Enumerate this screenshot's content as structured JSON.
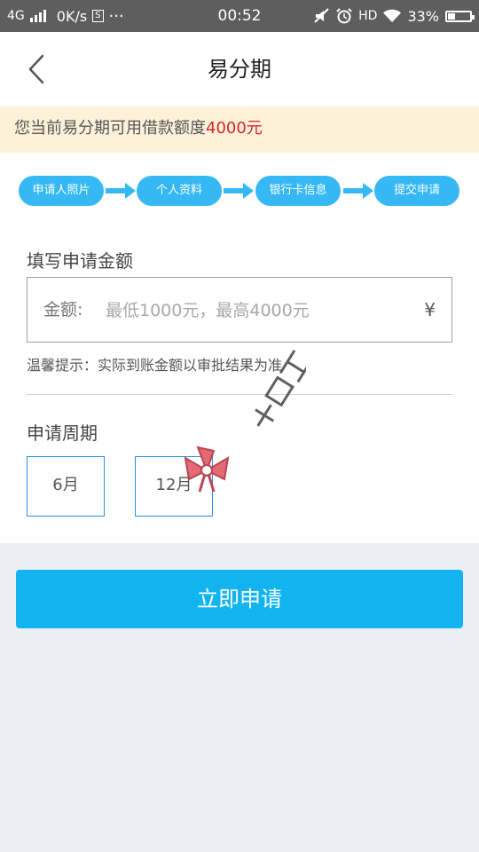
{
  "status_bar": {
    "network": "4G",
    "speed": "0K/s",
    "s_badge": "S",
    "dots": "···",
    "time": "00:52",
    "hd": "HD",
    "battery": "33%",
    "battery_level": 0.33
  },
  "header": {
    "title": "易分期"
  },
  "notice": {
    "prefix": "您当前易分期可用借款额度",
    "amount": "4000元"
  },
  "steps": [
    "申请人照片",
    "个人资料",
    "银行卡信息",
    "提交申请"
  ],
  "amount_section": {
    "title": "填写申请金额",
    "label": "金额:",
    "placeholder": "最低1000元，最高4000元",
    "currency": "¥",
    "tip": "温馨提示：实际到账金额以审批结果为准"
  },
  "period_section": {
    "title": "申请周期",
    "options": [
      "6月",
      "12月"
    ]
  },
  "apply_button": "立即申请",
  "watermark": "卡农社区",
  "colors": {
    "accent": "#12b4ef",
    "step": "#36b8f5",
    "highlight": "#d7262b",
    "notice_bg": "#fdf1d9"
  }
}
